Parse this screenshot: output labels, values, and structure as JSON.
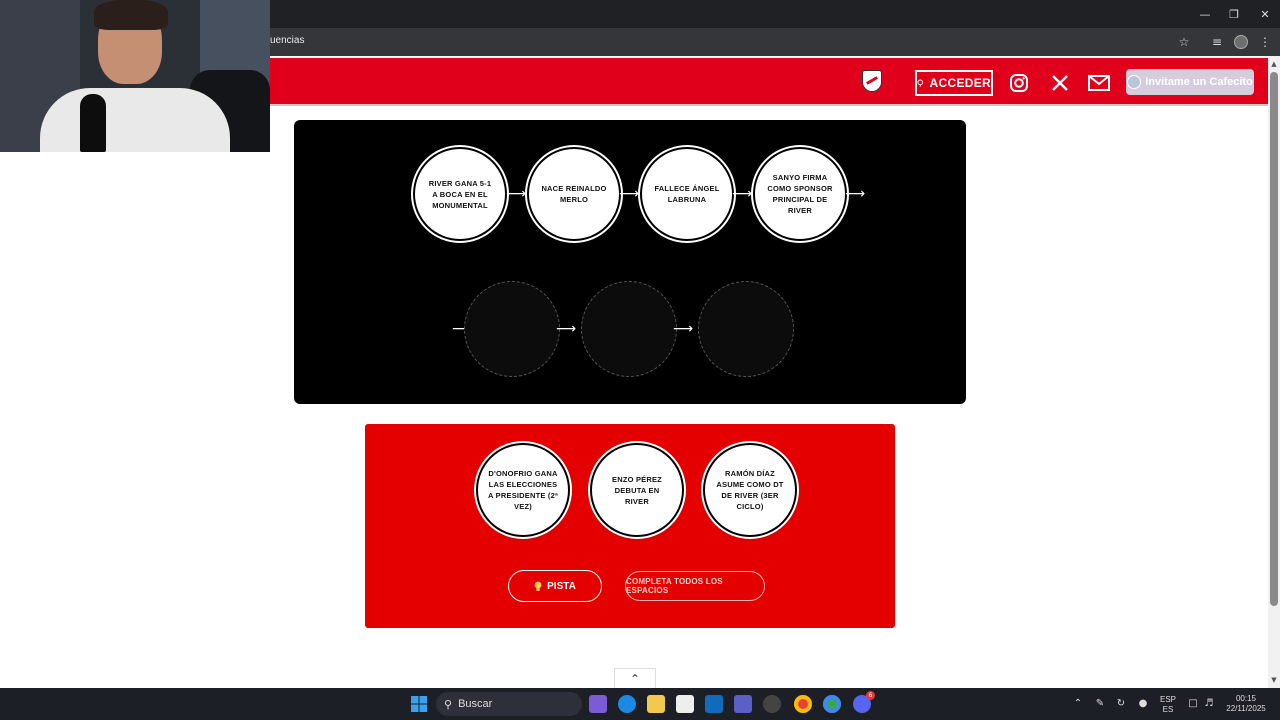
{
  "browser": {
    "url_fragment": "uencias",
    "window_controls": [
      "minimize-icon",
      "restore-icon",
      "close-icon"
    ]
  },
  "header": {
    "acceder_label": "ACCEDER",
    "cafecito_label": "Invitame un Cafecito",
    "icons": [
      "club-crest-icon",
      "instagram-icon",
      "x-icon",
      "mail-icon"
    ],
    "accent_color": "#e0001b"
  },
  "timeline": {
    "events": [
      "RIVER GANA 5-1 A BOCA EN EL MONUMENTAL",
      "NACE REINALDO MERLO",
      "FALLECE ÁNGEL LABRUNA",
      "SANYO FIRMA COMO SPONSOR PRINCIPAL DE RIVER"
    ],
    "empty_slots": 3
  },
  "options": {
    "cards": [
      "D'ONOFRIO GANA LAS ELECCIONES A PRESIDENTE (2ª VEZ)",
      "ENZO PÉREZ DEBUTA EN RIVER",
      "RAMÓN DÍAZ ASUME COMO DT DE RIVER (3ER CICLO)"
    ],
    "pista_label": "PISTA",
    "completa_label": "COMPLETA TODOS LOS ESPACIOS",
    "panel_color": "#e50000"
  },
  "taskbar": {
    "search_placeholder": "Buscar",
    "lang_line1": "ESP",
    "lang_line2": "ES",
    "time": "00:15",
    "date": "22/11/2025",
    "badge_count": "6"
  }
}
